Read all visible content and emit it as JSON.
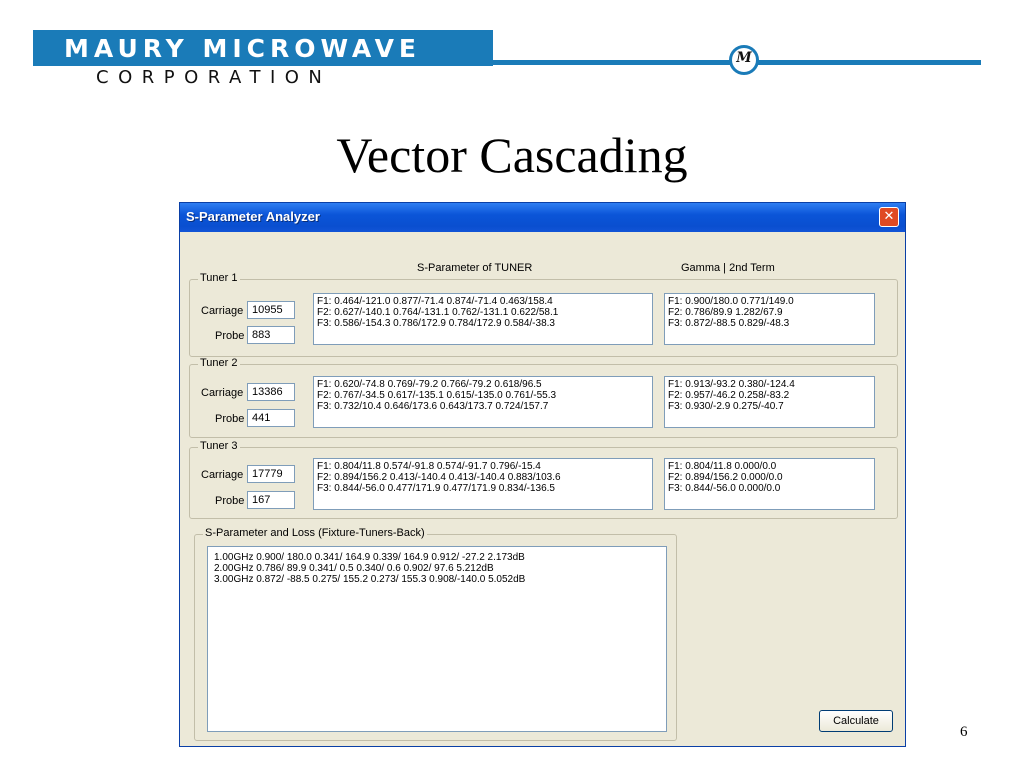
{
  "slide": {
    "brand_line1": "MAURY MICROWAVE",
    "brand_line2": "CORPORATION",
    "logo_text": "M",
    "title": "Vector Cascading",
    "page_number": "6"
  },
  "window": {
    "title": "S-Parameter Analyzer",
    "close_glyph": "✕",
    "col_head_sparam": "S-Parameter of TUNER",
    "col_head_gamma": "Gamma  |  2nd Term",
    "tuners": [
      {
        "label": "Tuner 1",
        "carriage_label": "Carriage",
        "carriage": "10955",
        "probe_label": "Probe",
        "probe": "883",
        "sparams": [
          "F1: 0.464/-121.0  0.877/-71.4  0.874/-71.4  0.463/158.4",
          "F2: 0.627/-140.1  0.764/-131.1  0.762/-131.1  0.622/58.1",
          "F3: 0.586/-154.3  0.786/172.9  0.784/172.9  0.584/-38.3"
        ],
        "gamma": [
          "F1: 0.900/180.0  0.771/149.0",
          "F2: 0.786/89.9  1.282/67.9",
          "F3: 0.872/-88.5  0.829/-48.3"
        ]
      },
      {
        "label": "Tuner 2",
        "carriage_label": "Carriage",
        "carriage": "13386",
        "probe_label": "Probe",
        "probe": "441",
        "sparams": [
          "F1: 0.620/-74.8  0.769/-79.2  0.766/-79.2  0.618/96.5",
          "F2: 0.767/-34.5  0.617/-135.1  0.615/-135.0  0.761/-55.3",
          "F3: 0.732/10.4  0.646/173.6  0.643/173.7  0.724/157.7"
        ],
        "gamma": [
          "F1: 0.913/-93.2  0.380/-124.4",
          "F2: 0.957/-46.2  0.258/-83.2",
          "F3: 0.930/-2.9  0.275/-40.7"
        ]
      },
      {
        "label": "Tuner 3",
        "carriage_label": "Carriage",
        "carriage": "17779",
        "probe_label": "Probe",
        "probe": "167",
        "sparams": [
          "F1: 0.804/11.8  0.574/-91.8  0.574/-91.7  0.796/-15.4",
          "F2: 0.894/156.2  0.413/-140.4  0.413/-140.4  0.883/103.6",
          "F3: 0.844/-56.0  0.477/171.9  0.477/171.9  0.834/-136.5"
        ],
        "gamma": [
          "F1: 0.804/11.8  0.000/0.0",
          "F2: 0.894/156.2  0.000/0.0",
          "F3: 0.844/-56.0  0.000/0.0"
        ]
      }
    ],
    "loss_group_label": "S-Parameter and Loss (Fixture-Tuners-Back)",
    "loss_lines": [
      "1.00GHz 0.900/ 180.0  0.341/ 164.9  0.339/ 164.9  0.912/ -27.2  2.173dB",
      "2.00GHz 0.786/  89.9  0.341/    0.5  0.340/    0.6  0.902/  97.6  5.212dB",
      "3.00GHz 0.872/ -88.5  0.275/ 155.2  0.273/ 155.3  0.908/-140.0  5.052dB"
    ],
    "calculate_label": "Calculate"
  },
  "colors": {
    "brand_blue": "#1a7bb8",
    "titlebar_blue": "#0b55d8",
    "close_red": "#e04a23",
    "dialog_bg": "#ece9d8"
  }
}
